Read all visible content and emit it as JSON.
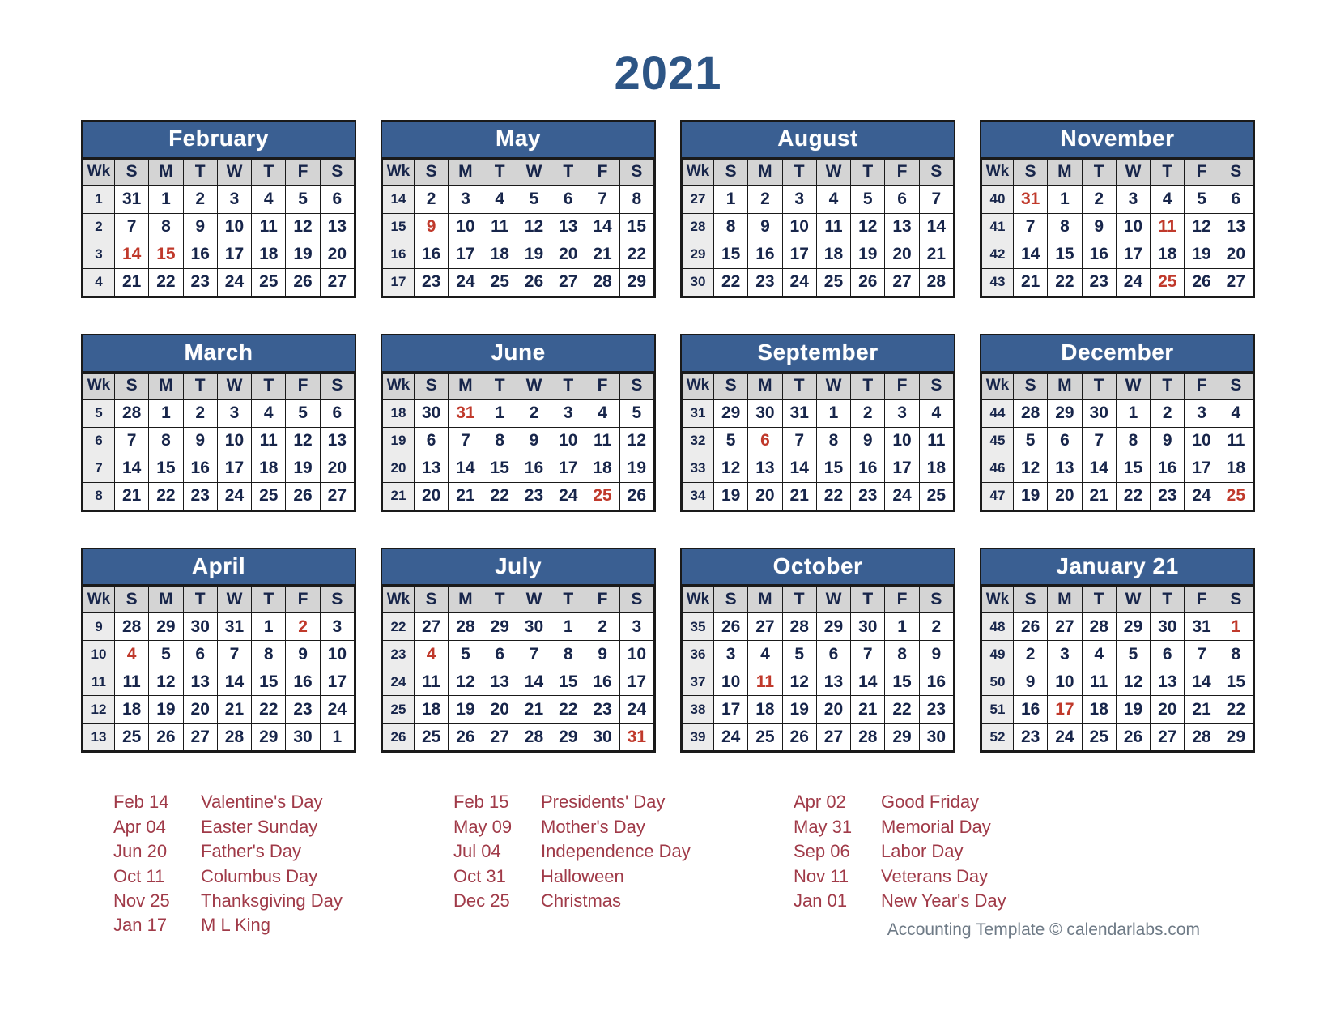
{
  "title": "2021",
  "colors": {
    "header_blue": "#3a5f92",
    "title_blue": "#2d5585",
    "holiday_red": "#c0392b",
    "legend_red": "#a03a48",
    "weekday_header_gray": "#d4d4d4",
    "week_col_gray": "#ececec",
    "footer_gray": "#6e7a86"
  },
  "weekday_headers": [
    "Wk",
    "S",
    "M",
    "T",
    "W",
    "T",
    "F",
    "S"
  ],
  "months": [
    {
      "name": "February",
      "weeks": [
        {
          "wk": "1",
          "days": [
            "31",
            "1",
            "2",
            "3",
            "4",
            "5",
            "6"
          ],
          "holidays": []
        },
        {
          "wk": "2",
          "days": [
            "7",
            "8",
            "9",
            "10",
            "11",
            "12",
            "13"
          ],
          "holidays": []
        },
        {
          "wk": "3",
          "days": [
            "14",
            "15",
            "16",
            "17",
            "18",
            "19",
            "20"
          ],
          "holidays": [
            0,
            1
          ]
        },
        {
          "wk": "4",
          "days": [
            "21",
            "22",
            "23",
            "24",
            "25",
            "26",
            "27"
          ],
          "holidays": []
        }
      ]
    },
    {
      "name": "May",
      "weeks": [
        {
          "wk": "14",
          "days": [
            "2",
            "3",
            "4",
            "5",
            "6",
            "7",
            "8"
          ],
          "holidays": []
        },
        {
          "wk": "15",
          "days": [
            "9",
            "10",
            "11",
            "12",
            "13",
            "14",
            "15"
          ],
          "holidays": [
            0
          ]
        },
        {
          "wk": "16",
          "days": [
            "16",
            "17",
            "18",
            "19",
            "20",
            "21",
            "22"
          ],
          "holidays": []
        },
        {
          "wk": "17",
          "days": [
            "23",
            "24",
            "25",
            "26",
            "27",
            "28",
            "29"
          ],
          "holidays": []
        }
      ]
    },
    {
      "name": "August",
      "weeks": [
        {
          "wk": "27",
          "days": [
            "1",
            "2",
            "3",
            "4",
            "5",
            "6",
            "7"
          ],
          "holidays": []
        },
        {
          "wk": "28",
          "days": [
            "8",
            "9",
            "10",
            "11",
            "12",
            "13",
            "14"
          ],
          "holidays": []
        },
        {
          "wk": "29",
          "days": [
            "15",
            "16",
            "17",
            "18",
            "19",
            "20",
            "21"
          ],
          "holidays": []
        },
        {
          "wk": "30",
          "days": [
            "22",
            "23",
            "24",
            "25",
            "26",
            "27",
            "28"
          ],
          "holidays": []
        }
      ]
    },
    {
      "name": "November",
      "weeks": [
        {
          "wk": "40",
          "days": [
            "31",
            "1",
            "2",
            "3",
            "4",
            "5",
            "6"
          ],
          "holidays": [
            0
          ]
        },
        {
          "wk": "41",
          "days": [
            "7",
            "8",
            "9",
            "10",
            "11",
            "12",
            "13"
          ],
          "holidays": [
            4
          ]
        },
        {
          "wk": "42",
          "days": [
            "14",
            "15",
            "16",
            "17",
            "18",
            "19",
            "20"
          ],
          "holidays": []
        },
        {
          "wk": "43",
          "days": [
            "21",
            "22",
            "23",
            "24",
            "25",
            "26",
            "27"
          ],
          "holidays": [
            4
          ]
        }
      ]
    },
    {
      "name": "March",
      "weeks": [
        {
          "wk": "5",
          "days": [
            "28",
            "1",
            "2",
            "3",
            "4",
            "5",
            "6"
          ],
          "holidays": []
        },
        {
          "wk": "6",
          "days": [
            "7",
            "8",
            "9",
            "10",
            "11",
            "12",
            "13"
          ],
          "holidays": []
        },
        {
          "wk": "7",
          "days": [
            "14",
            "15",
            "16",
            "17",
            "18",
            "19",
            "20"
          ],
          "holidays": []
        },
        {
          "wk": "8",
          "days": [
            "21",
            "22",
            "23",
            "24",
            "25",
            "26",
            "27"
          ],
          "holidays": []
        }
      ]
    },
    {
      "name": "June",
      "weeks": [
        {
          "wk": "18",
          "days": [
            "30",
            "31",
            "1",
            "2",
            "3",
            "4",
            "5"
          ],
          "holidays": [
            1
          ]
        },
        {
          "wk": "19",
          "days": [
            "6",
            "7",
            "8",
            "9",
            "10",
            "11",
            "12"
          ],
          "holidays": []
        },
        {
          "wk": "20",
          "days": [
            "13",
            "14",
            "15",
            "16",
            "17",
            "18",
            "19"
          ],
          "holidays": []
        },
        {
          "wk": "21",
          "days": [
            "20",
            "21",
            "22",
            "23",
            "24",
            "25",
            "26"
          ],
          "holidays": [
            5
          ]
        }
      ]
    },
    {
      "name": "September",
      "weeks": [
        {
          "wk": "31",
          "days": [
            "29",
            "30",
            "31",
            "1",
            "2",
            "3",
            "4"
          ],
          "holidays": []
        },
        {
          "wk": "32",
          "days": [
            "5",
            "6",
            "7",
            "8",
            "9",
            "10",
            "11"
          ],
          "holidays": [
            1
          ]
        },
        {
          "wk": "33",
          "days": [
            "12",
            "13",
            "14",
            "15",
            "16",
            "17",
            "18"
          ],
          "holidays": []
        },
        {
          "wk": "34",
          "days": [
            "19",
            "20",
            "21",
            "22",
            "23",
            "24",
            "25"
          ],
          "holidays": []
        }
      ]
    },
    {
      "name": "December",
      "weeks": [
        {
          "wk": "44",
          "days": [
            "28",
            "29",
            "30",
            "1",
            "2",
            "3",
            "4"
          ],
          "holidays": []
        },
        {
          "wk": "45",
          "days": [
            "5",
            "6",
            "7",
            "8",
            "9",
            "10",
            "11"
          ],
          "holidays": []
        },
        {
          "wk": "46",
          "days": [
            "12",
            "13",
            "14",
            "15",
            "16",
            "17",
            "18"
          ],
          "holidays": []
        },
        {
          "wk": "47",
          "days": [
            "19",
            "20",
            "21",
            "22",
            "23",
            "24",
            "25"
          ],
          "holidays": [
            6
          ]
        }
      ]
    },
    {
      "name": "April",
      "weeks": [
        {
          "wk": "9",
          "days": [
            "28",
            "29",
            "30",
            "31",
            "1",
            "2",
            "3"
          ],
          "holidays": [
            5
          ]
        },
        {
          "wk": "10",
          "days": [
            "4",
            "5",
            "6",
            "7",
            "8",
            "9",
            "10"
          ],
          "holidays": [
            0
          ]
        },
        {
          "wk": "11",
          "days": [
            "11",
            "12",
            "13",
            "14",
            "15",
            "16",
            "17"
          ],
          "holidays": []
        },
        {
          "wk": "12",
          "days": [
            "18",
            "19",
            "20",
            "21",
            "22",
            "23",
            "24"
          ],
          "holidays": []
        },
        {
          "wk": "13",
          "days": [
            "25",
            "26",
            "27",
            "28",
            "29",
            "30",
            "1"
          ],
          "holidays": []
        }
      ]
    },
    {
      "name": "July",
      "weeks": [
        {
          "wk": "22",
          "days": [
            "27",
            "28",
            "29",
            "30",
            "1",
            "2",
            "3"
          ],
          "holidays": []
        },
        {
          "wk": "23",
          "days": [
            "4",
            "5",
            "6",
            "7",
            "8",
            "9",
            "10"
          ],
          "holidays": [
            0
          ]
        },
        {
          "wk": "24",
          "days": [
            "11",
            "12",
            "13",
            "14",
            "15",
            "16",
            "17"
          ],
          "holidays": []
        },
        {
          "wk": "25",
          "days": [
            "18",
            "19",
            "20",
            "21",
            "22",
            "23",
            "24"
          ],
          "holidays": []
        },
        {
          "wk": "26",
          "days": [
            "25",
            "26",
            "27",
            "28",
            "29",
            "30",
            "31"
          ],
          "holidays": [
            6
          ]
        }
      ]
    },
    {
      "name": "October",
      "weeks": [
        {
          "wk": "35",
          "days": [
            "26",
            "27",
            "28",
            "29",
            "30",
            "1",
            "2"
          ],
          "holidays": []
        },
        {
          "wk": "36",
          "days": [
            "3",
            "4",
            "5",
            "6",
            "7",
            "8",
            "9"
          ],
          "holidays": []
        },
        {
          "wk": "37",
          "days": [
            "10",
            "11",
            "12",
            "13",
            "14",
            "15",
            "16"
          ],
          "holidays": [
            1
          ]
        },
        {
          "wk": "38",
          "days": [
            "17",
            "18",
            "19",
            "20",
            "21",
            "22",
            "23"
          ],
          "holidays": []
        },
        {
          "wk": "39",
          "days": [
            "24",
            "25",
            "26",
            "27",
            "28",
            "29",
            "30"
          ],
          "holidays": []
        }
      ]
    },
    {
      "name": "January 21",
      "weeks": [
        {
          "wk": "48",
          "days": [
            "26",
            "27",
            "28",
            "29",
            "30",
            "31",
            "1"
          ],
          "holidays": [
            6
          ]
        },
        {
          "wk": "49",
          "days": [
            "2",
            "3",
            "4",
            "5",
            "6",
            "7",
            "8"
          ],
          "holidays": []
        },
        {
          "wk": "50",
          "days": [
            "9",
            "10",
            "11",
            "12",
            "13",
            "14",
            "15"
          ],
          "holidays": []
        },
        {
          "wk": "51",
          "days": [
            "16",
            "17",
            "18",
            "19",
            "20",
            "21",
            "22"
          ],
          "holidays": [
            1
          ]
        },
        {
          "wk": "52",
          "days": [
            "23",
            "24",
            "25",
            "26",
            "27",
            "28",
            "29"
          ],
          "holidays": []
        }
      ]
    }
  ],
  "legend": {
    "columns": [
      [
        {
          "date": "Feb 14",
          "name": "Valentine's Day"
        },
        {
          "date": "Apr 04",
          "name": "Easter Sunday"
        },
        {
          "date": "Jun 20",
          "name": "Father's Day"
        },
        {
          "date": "Oct 11",
          "name": "Columbus Day"
        },
        {
          "date": "Nov 25",
          "name": "Thanksgiving Day"
        },
        {
          "date": "Jan 17",
          "name": "M L King"
        }
      ],
      [
        {
          "date": "Feb 15",
          "name": "Presidents' Day"
        },
        {
          "date": "May 09",
          "name": "Mother's Day"
        },
        {
          "date": "Jul 04",
          "name": "Independence Day"
        },
        {
          "date": "Oct 31",
          "name": "Halloween"
        },
        {
          "date": "Dec 25",
          "name": "Christmas"
        }
      ],
      [
        {
          "date": "Apr 02",
          "name": "Good Friday"
        },
        {
          "date": "May 31",
          "name": "Memorial Day"
        },
        {
          "date": "Sep 06",
          "name": "Labor Day"
        },
        {
          "date": "Nov 11",
          "name": "Veterans Day"
        },
        {
          "date": "Jan 01",
          "name": "New Year's Day"
        }
      ]
    ]
  },
  "footer": "Accounting Template © calendarlabs.com"
}
